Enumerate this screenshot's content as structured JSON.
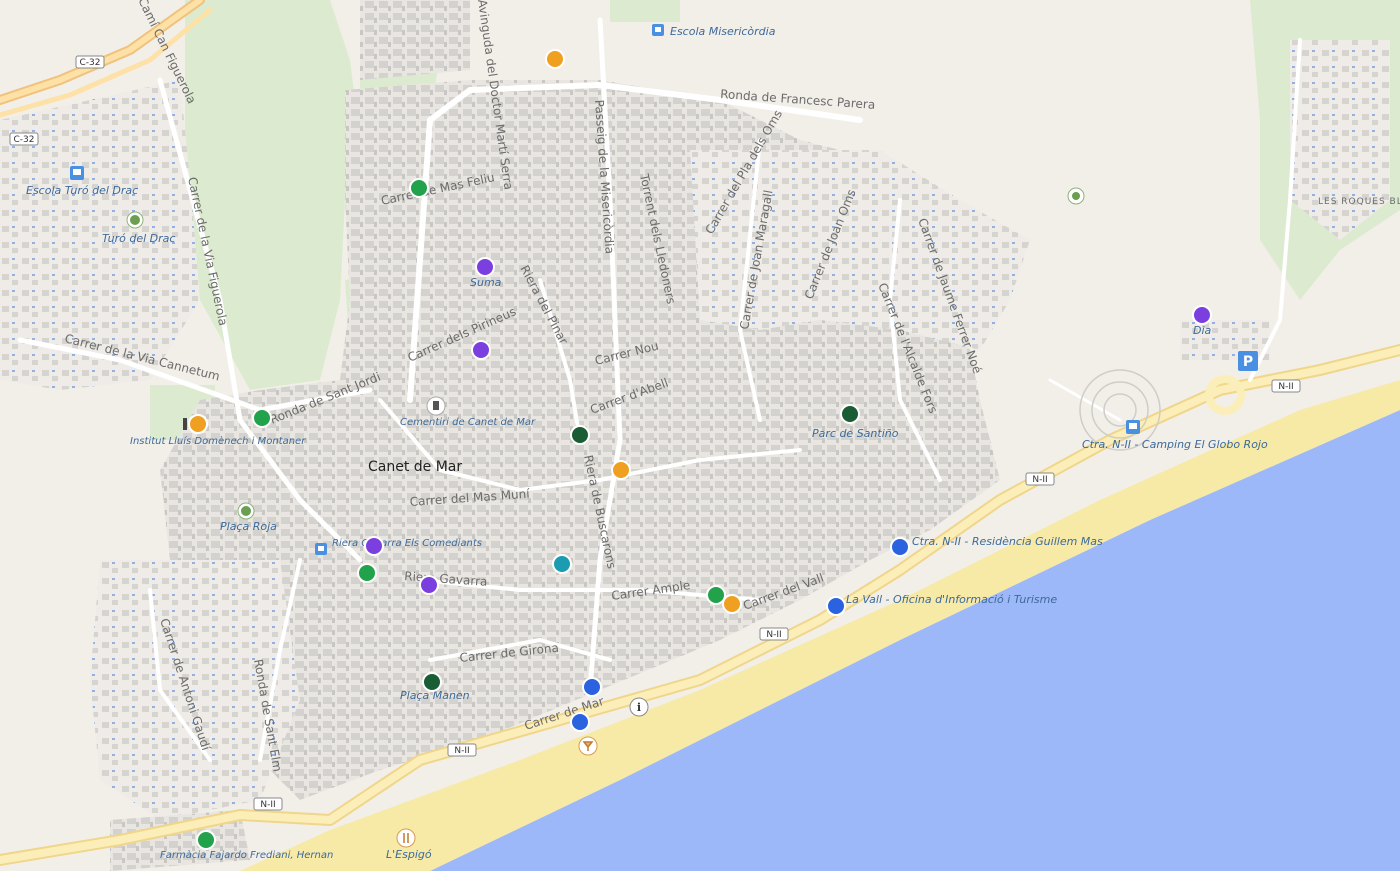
{
  "colors": {
    "land": "#f2efe9",
    "park": "#dcebcf",
    "sea": "#9db8f9",
    "beach": "#f7e9a6",
    "buildings": "#d8d6d2",
    "road_major": "#fde8b4",
    "poi_purple": "#7b3fe0",
    "poi_green": "#22a24a",
    "poi_darkgreen": "#1a5c34",
    "poi_orange": "#f0a020",
    "poi_blue": "#2a62e0",
    "poi_teal": "#1c9cb0"
  },
  "shields": [
    "C-32",
    "C-32",
    "N-II",
    "N-II",
    "N-II",
    "N-II",
    "N-II"
  ],
  "town_label": "Canet de Mar",
  "streets": [
    "Ronda de Francesc Parera",
    "Avinguda del Doctor Martí Serra",
    "Passeig de la Misericòrdia",
    "Torrent dels Lledoners",
    "Carrer del Pla dels Oms",
    "Carrer de Joan Maragall",
    "Carrer de Joan Oms",
    "Carrer de Jaume Ferrer Noé",
    "Carrer de l'Alcalde Fors",
    "Carrer de Mas Feliu",
    "Carrer dels Pirineus",
    "Riera del Pinar",
    "Carrer Nou",
    "Carrer d'Abell",
    "Carrer de la Via Figuerola",
    "Carrer de la Via Cannetum",
    "Ronda de Sant Jordi",
    "Carrer del Mas Muní",
    "Riera de Buscarons",
    "Riera Gavarra",
    "Carrer Ample",
    "Carrer de Girona",
    "Carrer de Antoni Gaudí",
    "Ronda de Sant Elm",
    "Carrer del Vall",
    "Camí Can Figuerola",
    "Carrer de Mar"
  ],
  "places": [
    "Escola Misericòrdia",
    "Escola Turó del Drac",
    "Turó del Drac",
    "Suma",
    "Dia",
    "Cementiri de Canet de Mar",
    "Institut Lluís Domènech i Montaner",
    "Parc de Santiño",
    "Plaça Roja",
    "Riera Gavarra Els Comediants",
    "Ctra. N-II - Camping El Globo Rojo",
    "Ctra. N-II - Residència Guillem Mas",
    "La Vall - Oficina d'Informació i Turisme",
    "Plaça Manen",
    "L'Espigó",
    "Farmàcia Fajardo Frediani, Hernan",
    "LES ROQUES BLANQUES"
  ]
}
